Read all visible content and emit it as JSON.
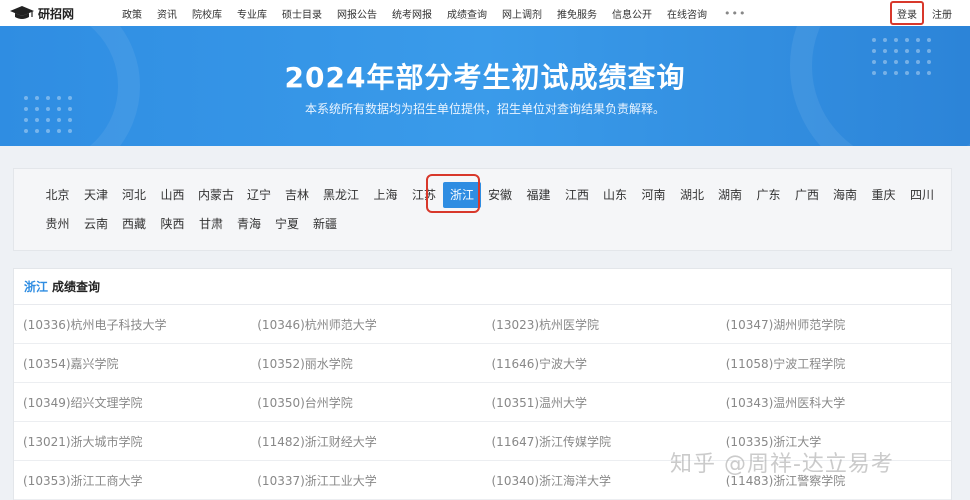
{
  "site": {
    "logo_text": "研招网"
  },
  "nav": {
    "items": [
      "政策",
      "资讯",
      "院校库",
      "专业库",
      "硕士目录",
      "网报公告",
      "统考网报",
      "成绩查询",
      "网上调剂",
      "推免服务",
      "信息公开",
      "在线咨询"
    ],
    "more": "•••",
    "login": "登录",
    "register": "注册"
  },
  "banner": {
    "title": "2024年部分考生初试成绩查询",
    "subtitle": "本系统所有数据均为招生单位提供，招生单位对查询结果负责解释。"
  },
  "provinces": {
    "row1": [
      "北京",
      "天津",
      "河北",
      "山西",
      "内蒙古",
      "辽宁",
      "吉林",
      "黑龙江",
      "上海",
      "江苏",
      "浙江",
      "安徽",
      "福建",
      "江西",
      "山东",
      "河南",
      "湖北",
      "湖南",
      "广东",
      "广西",
      "海南",
      "重庆",
      "四川"
    ],
    "row2": [
      "贵州",
      "云南",
      "西藏",
      "陕西",
      "甘肃",
      "青海",
      "宁夏",
      "新疆"
    ],
    "selected": "浙江"
  },
  "results": {
    "province": "浙江",
    "heading": "成绩查询",
    "rows": [
      [
        "(10336)杭州电子科技大学",
        "(10346)杭州师范大学",
        "(13023)杭州医学院",
        "(10347)湖州师范学院"
      ],
      [
        "(10354)嘉兴学院",
        "(10352)丽水学院",
        "(11646)宁波大学",
        "(11058)宁波工程学院"
      ],
      [
        "(10349)绍兴文理学院",
        "(10350)台州学院",
        "(10351)温州大学",
        "(10343)温州医科大学"
      ],
      [
        "(13021)浙大城市学院",
        "(11482)浙江财经大学",
        "(11647)浙江传媒学院",
        "(10335)浙江大学"
      ],
      [
        "(10353)浙江工商大学",
        "(10337)浙江工业大学",
        "(10340)浙江海洋大学",
        "(11483)浙江警察学院"
      ]
    ]
  },
  "watermark": "知乎 @周祥-达立易考",
  "colors": {
    "accent": "#2f8de2",
    "highlight": "#d8382b"
  }
}
